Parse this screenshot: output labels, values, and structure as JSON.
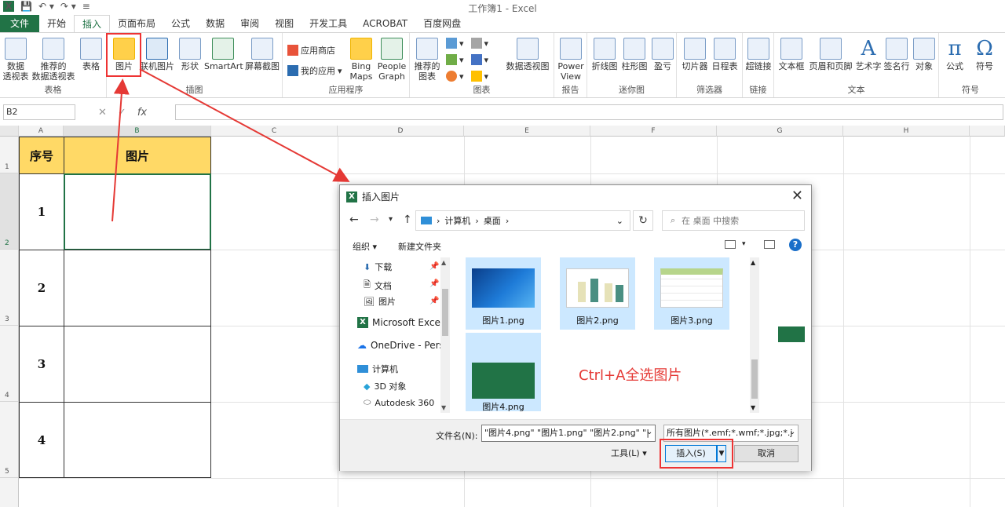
{
  "window": {
    "title": "工作簿1 - Excel"
  },
  "tabs": [
    {
      "label": "文件"
    },
    {
      "label": "开始"
    },
    {
      "label": "插入"
    },
    {
      "label": "页面布局"
    },
    {
      "label": "公式"
    },
    {
      "label": "数据"
    },
    {
      "label": "审阅"
    },
    {
      "label": "视图"
    },
    {
      "label": "开发工具"
    },
    {
      "label": "ACROBAT"
    },
    {
      "label": "百度网盘"
    }
  ],
  "ribbon": {
    "tables": {
      "pivot": "数据\n透视表",
      "rec_pivot": "推荐的\n数据透视表",
      "table": "表格",
      "group": "表格"
    },
    "illustrations": {
      "pictures": "图片",
      "online": "联机图片",
      "shapes": "形状",
      "smartart": "SmartArt",
      "screenshot": "屏幕截图",
      "group": "插图"
    },
    "apps": {
      "store": "应用商店",
      "my_apps": "我的应用",
      "bing": "Bing\nMaps",
      "people": "People\nGraph",
      "group": "应用程序"
    },
    "charts": {
      "recommended": "推荐的\n图表",
      "pivotchart": "数据透视图",
      "group": "图表"
    },
    "reports": {
      "power": "Power\nView",
      "group": "报告"
    },
    "sparklines": {
      "line": "折线图",
      "column": "柱形图",
      "winloss": "盈亏",
      "group": "迷你图"
    },
    "filters": {
      "slicer": "切片器",
      "timeline": "日程表",
      "group": "筛选器"
    },
    "links": {
      "hyperlink": "超链接",
      "group": "链接"
    },
    "text": {
      "textbox": "文本框",
      "headerfooter": "页眉和页脚",
      "wordart": "艺术字",
      "signature": "签名行",
      "object": "对象",
      "group": "文本"
    },
    "symbols": {
      "equation": "公式",
      "symbol": "符号",
      "group": "符号"
    }
  },
  "formula_bar": {
    "name_box": "B2",
    "fx": "fx",
    "value": ""
  },
  "columns": [
    "A",
    "B",
    "C",
    "D",
    "E",
    "F",
    "G",
    "H"
  ],
  "rows": [
    "1",
    "2",
    "3",
    "4",
    "5"
  ],
  "table": {
    "headers": [
      "序号",
      "图片"
    ],
    "serials": [
      "1",
      "2",
      "3",
      "4"
    ]
  },
  "dialog": {
    "title": "插入图片",
    "breadcrumb": [
      "计算机",
      "桌面"
    ],
    "search_placeholder": "在 桌面 中搜索",
    "organize": "组织 ▾",
    "new_folder": "新建文件夹",
    "sidebar": [
      {
        "label": "下载"
      },
      {
        "label": "文档"
      },
      {
        "label": "图片"
      },
      {
        "label": "Microsoft Excel"
      },
      {
        "label": "OneDrive - Perso"
      },
      {
        "label": "计算机"
      },
      {
        "label": "3D 对象"
      },
      {
        "label": "Autodesk 360"
      }
    ],
    "files": [
      {
        "name": "图片1.png",
        "selected": true
      },
      {
        "name": "图片2.png",
        "selected": true
      },
      {
        "name": "图片3.png",
        "selected": true
      },
      {
        "name": "图片4.png",
        "selected": true
      }
    ],
    "filename_label": "文件名(N):",
    "filename_value": "\"图片4.png\" \"图片1.png\" \"图片2.png\" \"|",
    "filetype": "所有图片(*.emf;*.wmf;*.jpg;*.j",
    "tools": "工具(L)",
    "insert": "插入(S)",
    "cancel": "取消"
  },
  "annotation": {
    "text": "Ctrl+A全选图片",
    "color": "#e53935"
  },
  "colors": {
    "excel_green": "#217346",
    "header_fill": "#ffd966",
    "highlight_red": "#e53935"
  }
}
